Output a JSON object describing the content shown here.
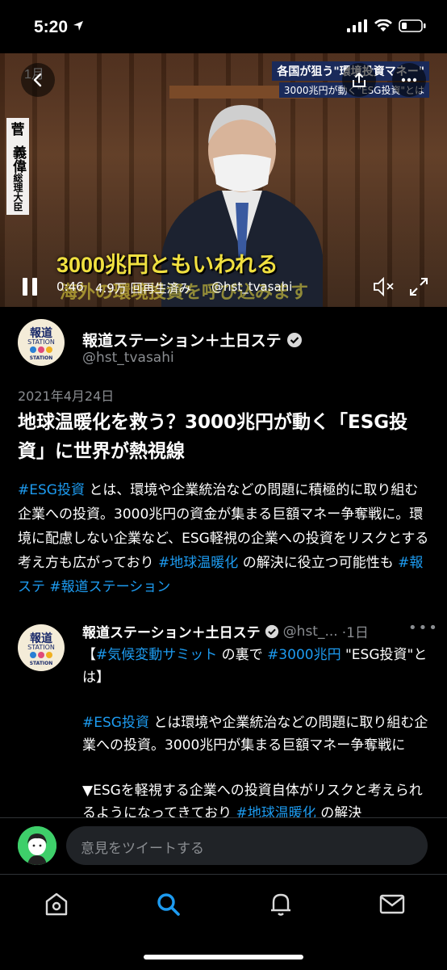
{
  "status_bar": {
    "time": "5:20"
  },
  "video": {
    "top_left_text": "1月",
    "caption_top_right": "各国が狙う\"環境投資マネー\"",
    "caption_top_right_sub": "3000兆円が動く\"ESG投資\"とは",
    "name_plate": {
      "family": "菅",
      "given": "義偉",
      "title": "総理大臣"
    },
    "caption_main": "3000兆円ともいわれる",
    "caption_sub": "海外の環境投資を呼び込みます",
    "time": "0:46",
    "views": "4.9万 回再生済み",
    "handle": "@hst_tvasahi"
  },
  "account_avatar": {
    "line1": "報道",
    "line2": "STATION",
    "line3": "STATION",
    "dot_colors": [
      "#2a7fd4",
      "#e04a7a",
      "#f0b020"
    ]
  },
  "tweet": {
    "display_name": "報道ステーション＋土日ステ",
    "handle": "@hst_tvasahi",
    "date": "2021年4月24日",
    "headline": "地球温暖化を救う？3000兆円が動く「ESG投資」に世界が熱視線",
    "body": {
      "tag1": "#ESG投資",
      "text1": " とは、環境や企業統治などの問題に積極的に取り組む企業への投資。3000兆円の資金が集まる巨額マネー争奪戦に。環境に配慮しない企業など、ESG軽視の企業への投資をリスクとする考え方も広がっており ",
      "tag2": "#地球温暖化",
      "text2": " の解決に役立つ可能性も ",
      "tag3": "#報ステ",
      "tag4": "#報道ステーション"
    }
  },
  "reply": {
    "display_name": "報道ステーション＋土日ステ",
    "handle": "@hst_...",
    "time": "·1日",
    "p1_a": "【",
    "p1_tag1": "#気候変動サミット",
    "p1_b": " の裏で ",
    "p1_tag2": "#3000兆円",
    "p1_c": " \"ESG投資\"とは】",
    "p2_tag": "#ESG投資",
    "p2_text": " とは環境や企業統治などの問題に取り組む企業への投資。3000兆円が集まる巨額マネー争奪戦に",
    "p3_text": "▼ESGを軽視する企業への投資自体がリスクと考えられるようになってきており ",
    "p3_tag": "#地球温暖化",
    "p3_tail": " の解決"
  },
  "compose": {
    "placeholder": "意見をツイートする"
  },
  "colors": {
    "link": "#1d9bf0",
    "background": "#000000",
    "secondary_text": "#8a8d91"
  },
  "tabs": [
    {
      "icon": "home-icon"
    },
    {
      "icon": "search-icon",
      "active": true
    },
    {
      "icon": "bell-icon"
    },
    {
      "icon": "mail-icon"
    }
  ]
}
